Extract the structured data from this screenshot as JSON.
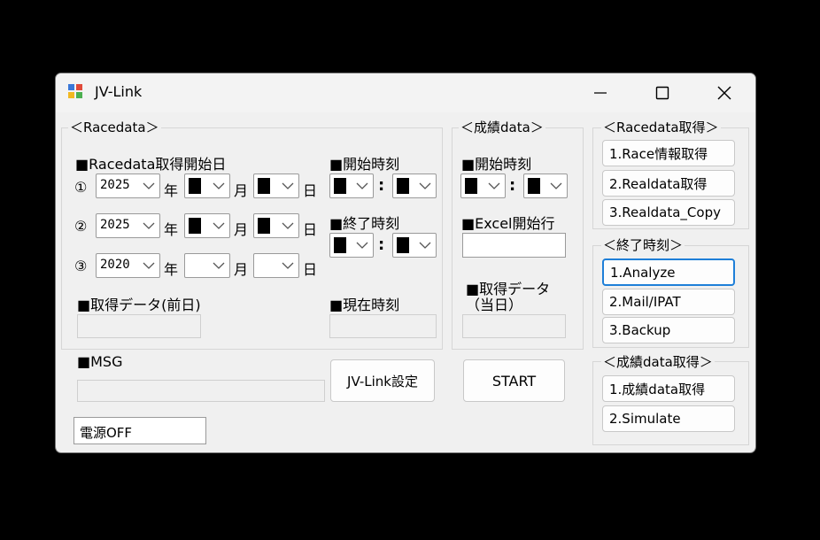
{
  "window": {
    "title": "JV-Link",
    "controls": {
      "minimize": "minimize-icon",
      "maximize": "maximize-icon",
      "close": "close-icon"
    }
  },
  "racedata": {
    "group_label": "＜Racedata＞",
    "start_date_label": "■Racedata取得開始日",
    "rows": [
      {
        "marker": "①",
        "year": "2025",
        "year_unit": "年",
        "month_unit": "月",
        "day_unit": "日"
      },
      {
        "marker": "②",
        "year": "2025",
        "year_unit": "年",
        "month_unit": "月",
        "day_unit": "日"
      },
      {
        "marker": "③",
        "year": "2020",
        "year_unit": "年",
        "month_unit": "月",
        "day_unit": "日"
      }
    ],
    "start_time_label": "■開始時刻",
    "end_time_label": "■終了時刻",
    "prev_day_label": "■取得データ(前日)",
    "current_time_label": "■現在時刻",
    "colon": ":"
  },
  "seiseki": {
    "group_label": "＜成績data＞",
    "start_time_label": "■開始時刻",
    "excel_start_label": "■Excel開始行",
    "today_label_line1": "■取得データ",
    "today_label_line2": "（当日）",
    "colon": ":"
  },
  "msg_label": "■MSG",
  "buttons": {
    "jvlink_settings": "JV-Link設定",
    "start": "START",
    "power_off": "電源OFF"
  },
  "racedata_get": {
    "group_label": "＜Racedata取得＞",
    "items": [
      "1.Race情報取得",
      "2.Realdata取得",
      "3.Realdata_Copy"
    ]
  },
  "end_time": {
    "group_label": "＜終了時刻＞",
    "items": [
      "1.Analyze",
      "2.Mail/IPAT",
      "3.Backup"
    ]
  },
  "seiseki_get": {
    "group_label": "＜成績data取得＞",
    "items": [
      "1.成績data取得",
      "2.Simulate"
    ]
  }
}
